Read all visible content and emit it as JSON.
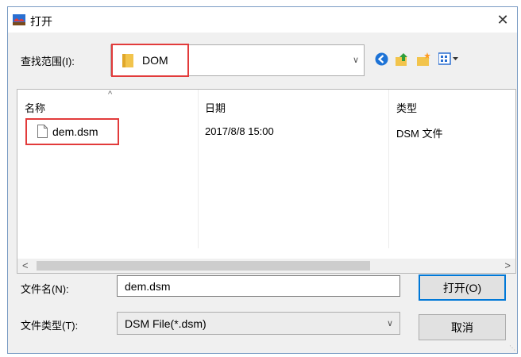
{
  "window": {
    "title": "打开",
    "close_label": "✕"
  },
  "lookin": {
    "label": "查找范围(I):",
    "value": "DOM"
  },
  "toolbar": {
    "icons": [
      "back-icon",
      "up-folder-icon",
      "new-folder-icon",
      "view-menu-icon"
    ]
  },
  "list": {
    "columns": [
      "名称",
      "日期",
      "类型"
    ],
    "rows": [
      {
        "name": "dem.dsm",
        "date": "2017/8/8 15:00",
        "type": "DSM 文件"
      }
    ]
  },
  "filename": {
    "label": "文件名(N):",
    "value": "dem.dsm"
  },
  "filetype": {
    "label": "文件类型(T):",
    "value": "DSM File(*.dsm)"
  },
  "buttons": {
    "open": "打开(O)",
    "cancel": "取消"
  },
  "colors": {
    "highlight": "#e23b3b",
    "accent": "#0078d7"
  }
}
